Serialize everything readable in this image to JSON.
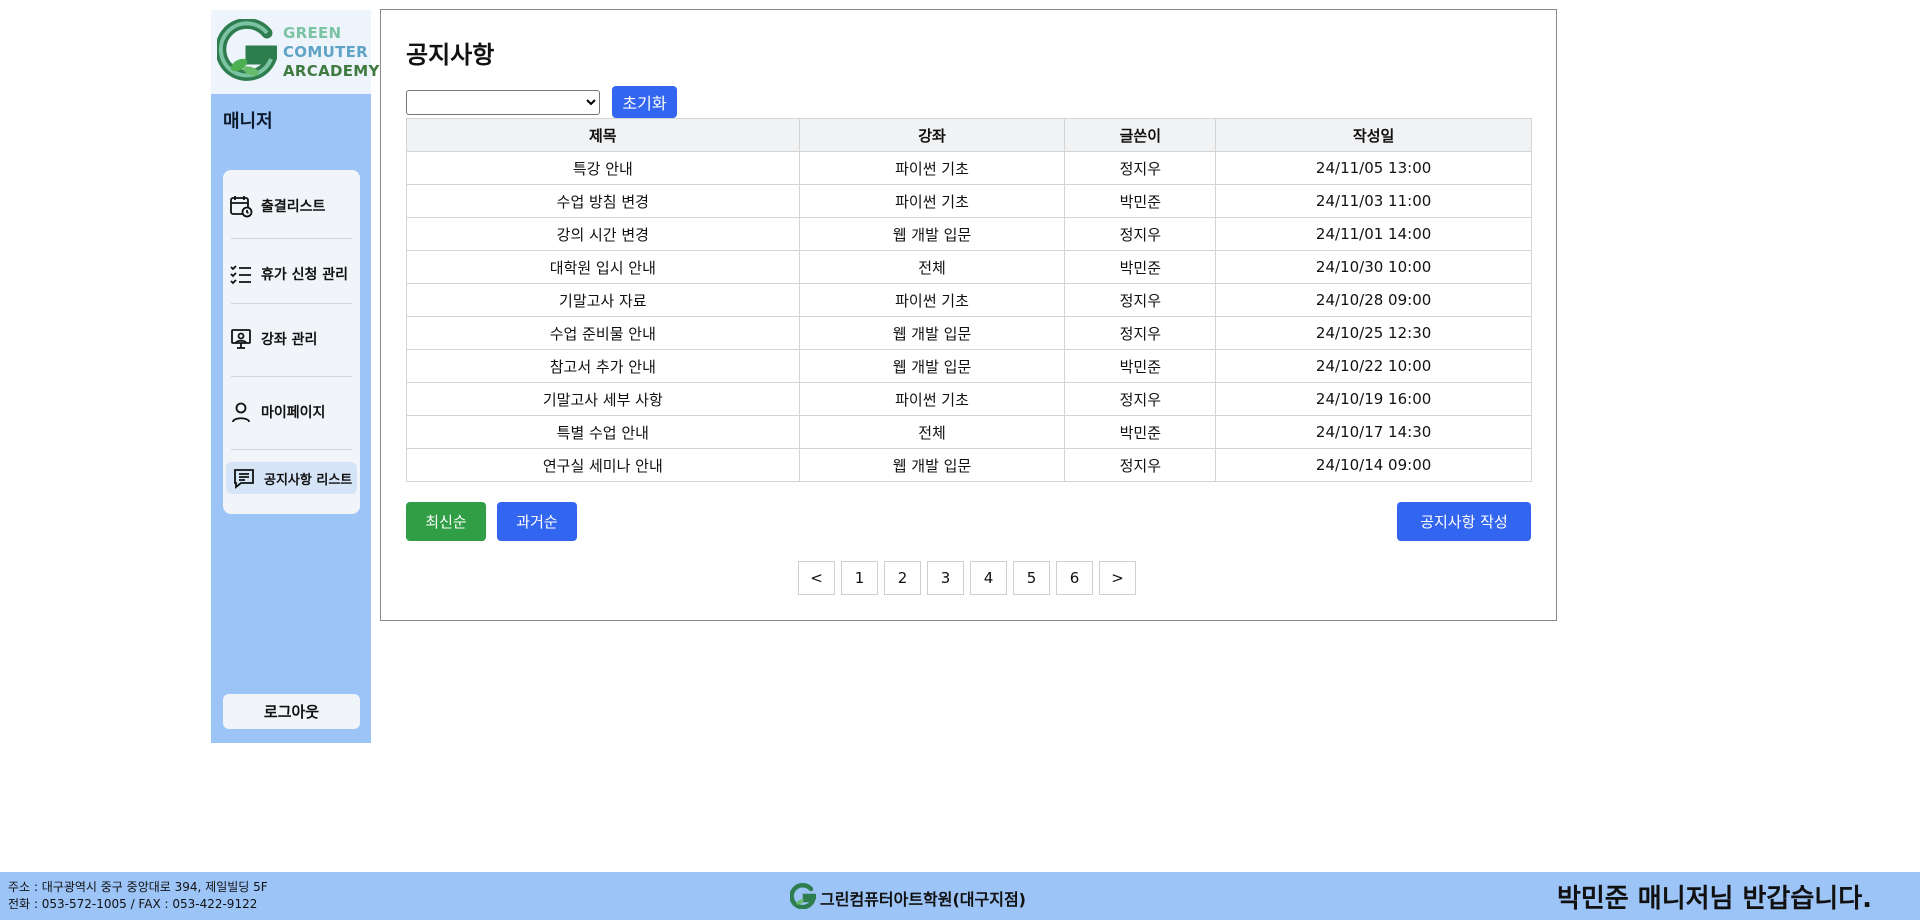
{
  "sidebar": {
    "logo": {
      "line1": "GREEN",
      "line2": "COMUTER",
      "line3": "ARCADEMY"
    },
    "role": "매니저",
    "items": [
      {
        "label": "출결리스트",
        "icon": "calendar-clock-icon"
      },
      {
        "label": "휴가 신청 관리",
        "icon": "checklist-icon"
      },
      {
        "label": "강좌 관리",
        "icon": "lecture-board-icon"
      },
      {
        "label": "마이페이지",
        "icon": "user-icon"
      },
      {
        "label": "공지사항 리스트",
        "icon": "message-icon",
        "active": true
      }
    ],
    "logout": "로그아웃"
  },
  "main": {
    "title": "공지사항",
    "filter": {
      "selected": ""
    },
    "reset_label": "초기화",
    "table": {
      "headers": {
        "title": "제목",
        "course": "강좌",
        "writer": "글쓴이",
        "date": "작성일"
      },
      "rows": [
        {
          "title": "특강 안내",
          "course": "파이썬 기초",
          "writer": "정지우",
          "date": "24/11/05 13:00"
        },
        {
          "title": "수업 방침 변경",
          "course": "파이썬 기초",
          "writer": "박민준",
          "date": "24/11/03 11:00"
        },
        {
          "title": "강의 시간 변경",
          "course": "웹 개발 입문",
          "writer": "정지우",
          "date": "24/11/01 14:00"
        },
        {
          "title": "대학원 입시 안내",
          "course": "전체",
          "writer": "박민준",
          "date": "24/10/30 10:00"
        },
        {
          "title": "기말고사 자료",
          "course": "파이썬 기초",
          "writer": "정지우",
          "date": "24/10/28 09:00"
        },
        {
          "title": "수업 준비물 안내",
          "course": "웹 개발 입문",
          "writer": "정지우",
          "date": "24/10/25 12:30"
        },
        {
          "title": "참고서 추가 안내",
          "course": "웹 개발 입문",
          "writer": "박민준",
          "date": "24/10/22 10:00"
        },
        {
          "title": "기말고사 세부 사항",
          "course": "파이썬 기초",
          "writer": "정지우",
          "date": "24/10/19 16:00"
        },
        {
          "title": "특별 수업 안내",
          "course": "전체",
          "writer": "박민준",
          "date": "24/10/17 14:30"
        },
        {
          "title": "연구실 세미나 안내",
          "course": "웹 개발 입문",
          "writer": "정지우",
          "date": "24/10/14 09:00"
        }
      ]
    },
    "sort_newest": "최신순",
    "sort_oldest": "과거순",
    "write_label": "공지사항 작성",
    "pagination": {
      "prev": "<",
      "pages": [
        "1",
        "2",
        "3",
        "4",
        "5",
        "6"
      ],
      "next": ">"
    }
  },
  "footer": {
    "address": "주소 : 대구광역시 중구 중앙대로 394, 제일빌딩 5F",
    "phone": "전화 : 053-572-1005 / FAX : 053-422-9122",
    "brand": "그린컴퓨터아트학원(대구지점)",
    "welcome": "박민준 매니저님 반갑습니다."
  },
  "colors": {
    "sidebar_bg": "#9cc4f7",
    "primary": "#3366f0",
    "success": "#2f9e44"
  }
}
